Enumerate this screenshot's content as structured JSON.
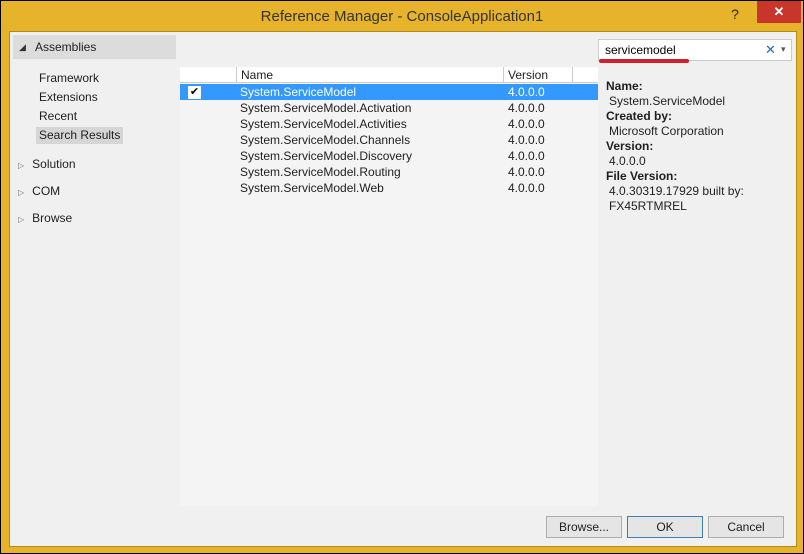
{
  "window": {
    "title": "Reference Manager - ConsoleApplication1",
    "help_label": "?",
    "close_label": "✕",
    "accent": "#E6B32A"
  },
  "sidebar": {
    "header": "Assemblies",
    "items": [
      {
        "label": "Framework"
      },
      {
        "label": "Extensions"
      },
      {
        "label": "Recent"
      },
      {
        "label": "Search Results",
        "selected": true
      }
    ],
    "groups": [
      {
        "label": "Solution"
      },
      {
        "label": "COM"
      },
      {
        "label": "Browse"
      }
    ]
  },
  "search": {
    "value": "servicemodel",
    "clear_icon": "✕",
    "dropdown_icon": "▾"
  },
  "table": {
    "columns": [
      "Name",
      "Version"
    ],
    "rows": [
      {
        "name": "System.ServiceModel",
        "version": "4.0.0.0",
        "checked": true,
        "selected": true
      },
      {
        "name": "System.ServiceModel.Activation",
        "version": "4.0.0.0"
      },
      {
        "name": "System.ServiceModel.Activities",
        "version": "4.0.0.0"
      },
      {
        "name": "System.ServiceModel.Channels",
        "version": "4.0.0.0"
      },
      {
        "name": "System.ServiceModel.Discovery",
        "version": "4.0.0.0"
      },
      {
        "name": "System.ServiceModel.Routing",
        "version": "4.0.0.0"
      },
      {
        "name": "System.ServiceModel.Web",
        "version": "4.0.0.0"
      }
    ]
  },
  "details": {
    "name_label": "Name:",
    "name_value": "System.ServiceModel",
    "created_label": "Created by:",
    "created_value": "Microsoft Corporation",
    "version_label": "Version:",
    "version_value": "4.0.0.0",
    "file_version_label": "File Version:",
    "file_version_line1": "4.0.30319.17929 built by:",
    "file_version_line2": "FX45RTMREL"
  },
  "buttons": {
    "browse": "Browse...",
    "ok": "OK",
    "cancel": "Cancel"
  }
}
